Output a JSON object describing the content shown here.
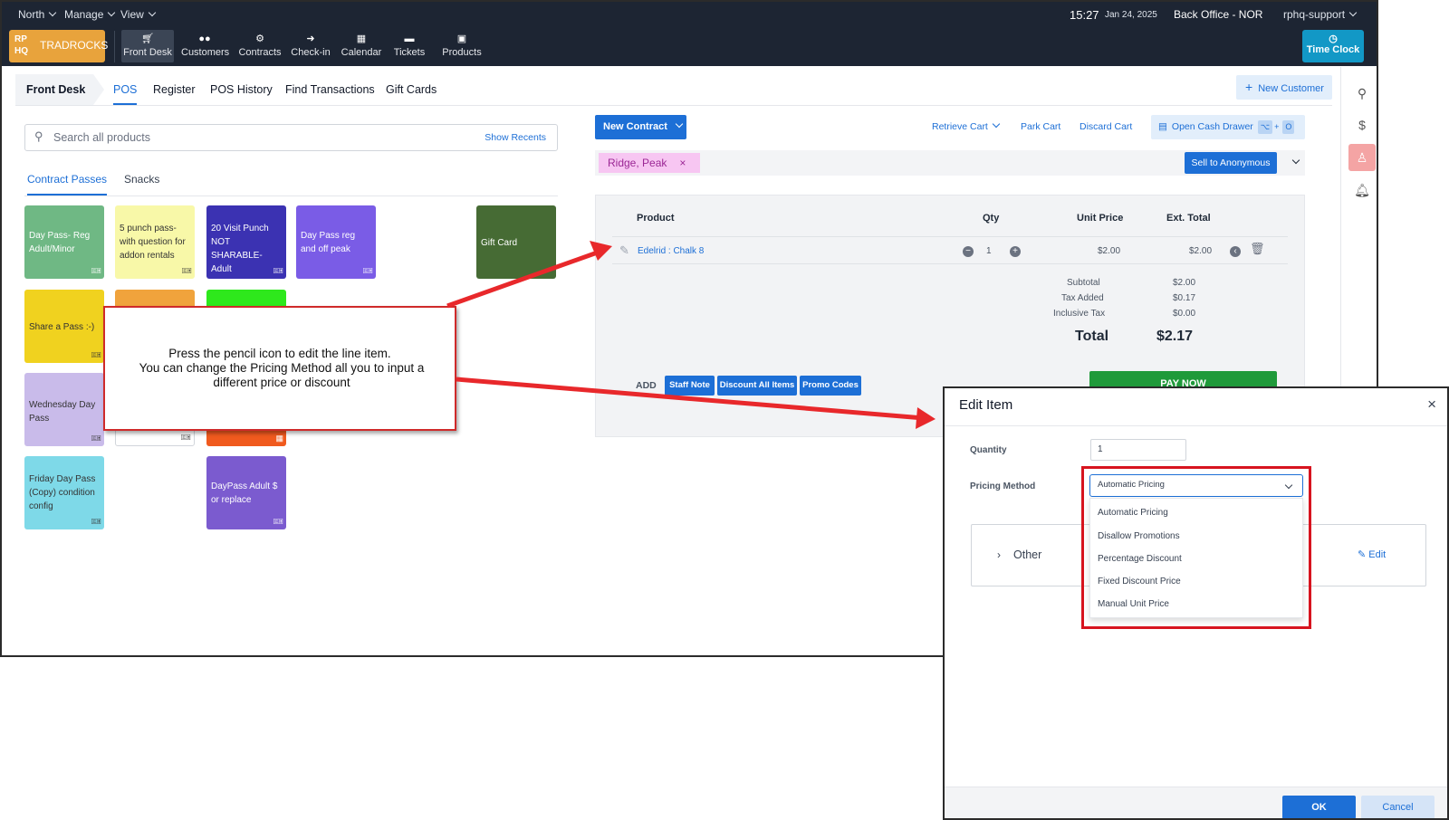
{
  "topbar": {
    "menus": [
      "North",
      "Manage",
      "View"
    ],
    "time": "15:27",
    "date": "Jan 24, 2025",
    "location": "Back Office - NOR",
    "user": "rphq-support"
  },
  "brand": {
    "mark": "RP HQ",
    "name": "TRADROCKS",
    "color": "#e8a33c"
  },
  "nav": {
    "items": [
      "Front Desk",
      "Customers",
      "Contracts",
      "Check-in",
      "Calendar",
      "Tickets",
      "Products"
    ],
    "active": "Front Desk",
    "time_clock": "Time Clock"
  },
  "subnav": {
    "breadcrumb": "Front Desk",
    "tabs": [
      "POS",
      "Register",
      "POS History",
      "Find Transactions",
      "Gift Cards"
    ],
    "active": "POS",
    "new_customer": "New Customer"
  },
  "search": {
    "placeholder": "Search all products",
    "recents": "Show Recents"
  },
  "categories": {
    "tabs": [
      "Contract Passes",
      "Snacks"
    ],
    "active": "Contract Passes"
  },
  "products": [
    {
      "label": "Day Pass- Reg Adult/Minor",
      "color": "#6fb884",
      "text_color": "#ffffff"
    },
    {
      "label": "5 punch pass- with question for addon rentals",
      "color": "#f8f8a8",
      "text_color": "#333333"
    },
    {
      "label": "20 Visit Punch NOT SHARABLE- Adult",
      "color": "#3b32b2",
      "text_color": "#ffffff"
    },
    {
      "label": "Day Pass reg and off peak",
      "color": "#7a5ce6",
      "text_color": "#ffffff"
    },
    {
      "label": "Gift Card",
      "color": "#466b34",
      "text_color": "#ffffff"
    },
    {
      "label": "Share a Pass :-)",
      "color": "#f0d21f",
      "text_color": "#333333"
    },
    {
      "label": "",
      "color": "#f0a33c",
      "text_color": "#ffffff"
    },
    {
      "label": "",
      "color": "#2ee81c",
      "text_color": "#ffffff"
    },
    {
      "label": "Wednesday Day Pass",
      "color": "#c9bbea",
      "text_color": "#333333"
    },
    {
      "label": "",
      "color": "#ffffff",
      "text_color": "#333333"
    },
    {
      "label": "",
      "color": "#f05a1e",
      "text_color": "#ffffff"
    },
    {
      "label": "Friday Day Pass (Copy) condition config",
      "color": "#7ed9e8",
      "text_color": "#333333"
    },
    {
      "label": "DayPass Adult $ or replace",
      "color": "#7b5bcf",
      "text_color": "#ffffff"
    }
  ],
  "cart": {
    "new_contract": "New Contract",
    "actions": [
      "Retrieve Cart",
      "Park Cart",
      "Discard Cart"
    ],
    "open_cash_drawer": "Open Cash Drawer",
    "shortcut_keys": [
      "⌥",
      "+",
      "O"
    ],
    "customer": "Ridge, Peak",
    "sell_anonymous": "Sell to Anonymous",
    "headers": {
      "product": "Product",
      "qty": "Qty",
      "unit_price": "Unit Price",
      "ext_total": "Ext. Total"
    },
    "line": {
      "product": "Edelrid : Chalk 8",
      "qty": "1",
      "unit_price": "$2.00",
      "ext_total": "$2.00"
    },
    "subtotal_label": "Subtotal",
    "subtotal": "$2.00",
    "tax_label": "Tax Added",
    "tax": "$0.17",
    "incl_label": "Inclusive Tax",
    "incl": "$0.00",
    "total_label": "Total",
    "total": "$2.17",
    "add_label": "ADD",
    "add_buttons": [
      "Staff Note",
      "Discount All Items",
      "Promo Codes"
    ],
    "pay_now": "PAY NOW"
  },
  "callout": {
    "line1": "Press the pencil icon to edit the line item.",
    "line2": "You can change the Pricing Method all you to input a different price or discount"
  },
  "dialog": {
    "title": "Edit Item",
    "close": "×",
    "quantity_label": "Quantity",
    "quantity": "1",
    "pricing_label": "Pricing Method",
    "pricing_value": "Automatic Pricing",
    "options": [
      "Automatic Pricing",
      "Disallow Promotions",
      "Percentage Discount",
      "Fixed Discount Price",
      "Manual Unit Price"
    ],
    "other_label": "Other",
    "edit_label": "Edit",
    "ok": "OK",
    "cancel": "Cancel"
  },
  "colors": {
    "accent": "#1d6fd6",
    "topbar": "#1d2533",
    "pay_now": "#1f9a3a",
    "annotation_red": "#d7141f"
  }
}
